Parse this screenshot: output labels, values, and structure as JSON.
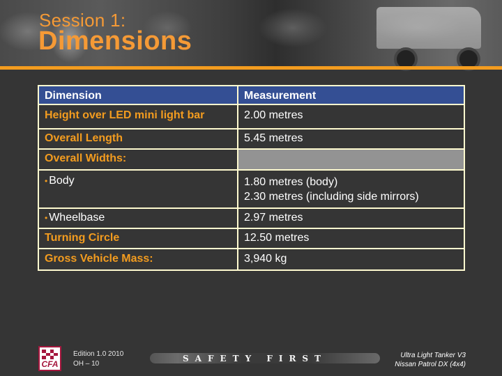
{
  "header": {
    "session_label": "Session 1:",
    "title": "Dimensions"
  },
  "colors": {
    "accent_orange": "#f39c1f",
    "header_blue": "#344f94",
    "border_cream": "#fffbd0",
    "background": "#353535",
    "empty_cell_grey": "#939393",
    "cfa_red": "#a5173e"
  },
  "table": {
    "headers": [
      "Dimension",
      "Measurement"
    ],
    "rows": [
      {
        "dimension": "Height over LED mini light bar",
        "measurement": "2.00 metres"
      },
      {
        "dimension": "Overall Length",
        "measurement": "5.45 metres"
      },
      {
        "dimension": "Overall Widths:",
        "measurement": ""
      },
      {
        "dimension": "Body",
        "measurement_line1": "1.80 metres (body)",
        "measurement_line2": "2.30 metres (including side mirrors)"
      },
      {
        "dimension": "Wheelbase",
        "measurement": "2.97 metres"
      },
      {
        "dimension": "Turning Circle",
        "measurement": "12.50 metres"
      },
      {
        "dimension": "Gross Vehicle Mass:",
        "measurement": "3,940 kg"
      }
    ],
    "bullet_glyph": "•"
  },
  "footer": {
    "logo_text": "CFA",
    "edition": "Edition 1.0  2010",
    "page_code": "OH – 10",
    "slogan": "SAFETY FIRST",
    "model_line1": "Ultra Light Tanker V3",
    "model_line2": "Nissan Patrol DX (4x4)"
  }
}
